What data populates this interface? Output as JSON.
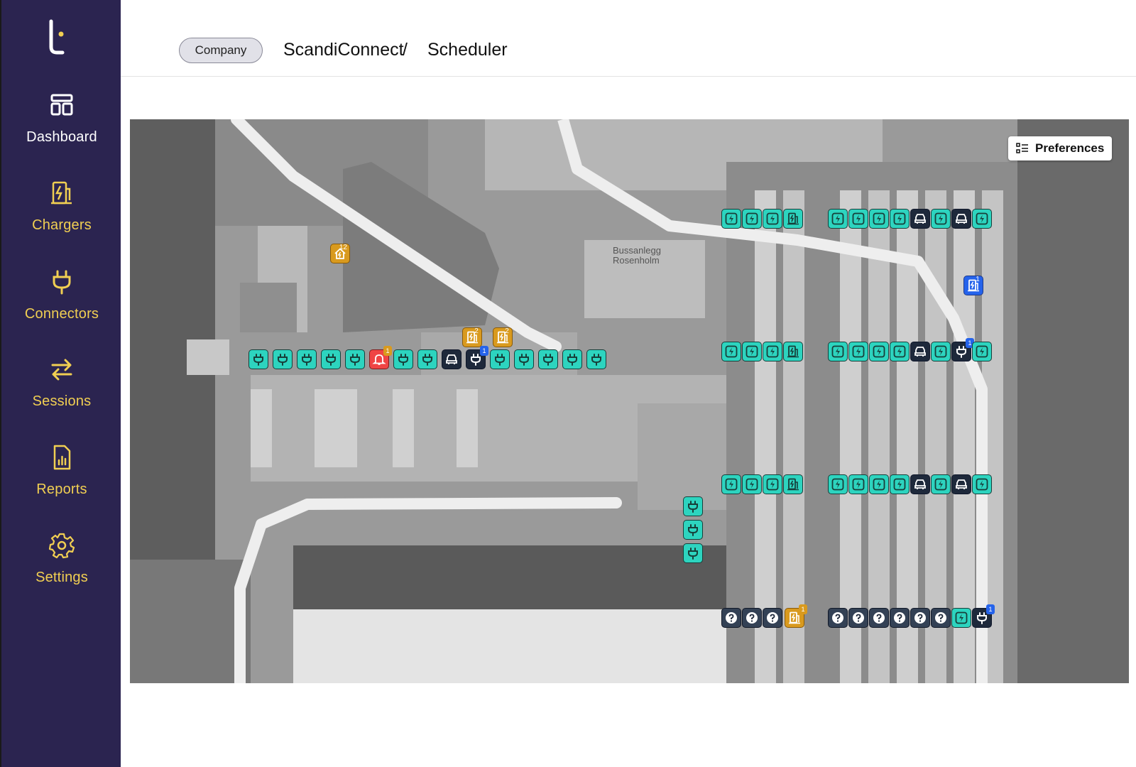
{
  "sidebar": {
    "items": [
      {
        "label": "Dashboard",
        "icon": "dashboard-icon",
        "active": true
      },
      {
        "label": "Chargers",
        "icon": "charger-icon",
        "active": false
      },
      {
        "label": "Connectors",
        "icon": "connector-plug-icon",
        "active": false
      },
      {
        "label": "Sessions",
        "icon": "sessions-arrows-icon",
        "active": false
      },
      {
        "label": "Reports",
        "icon": "reports-chart-icon",
        "active": false
      },
      {
        "label": "Settings",
        "icon": "gear-icon",
        "active": false
      }
    ]
  },
  "header": {
    "scope_pill": "Company",
    "breadcrumb": [
      "ScandiConnect",
      "/",
      "Scheduler"
    ]
  },
  "map": {
    "preferences_label": "Preferences",
    "place_label_line1": "Bussanlegg",
    "place_label_line2": "Rosenholm",
    "markers": {
      "site_badge": "12",
      "charger_group_badges": [
        "2",
        "2",
        "1",
        "1"
      ],
      "alert_badge": "1",
      "connector_badges": [
        "1",
        "1",
        "1"
      ]
    }
  },
  "colors": {
    "sidebar_bg": "#2b2450",
    "nav_label": "#f1cf52",
    "marker_available": "#2dd4bf",
    "marker_occupied": "#1e293b",
    "marker_faulted": "#ef4444",
    "marker_unknown": "#334155",
    "marker_charger_group": "#d99a1e",
    "marker_selected": "#2563eb"
  }
}
